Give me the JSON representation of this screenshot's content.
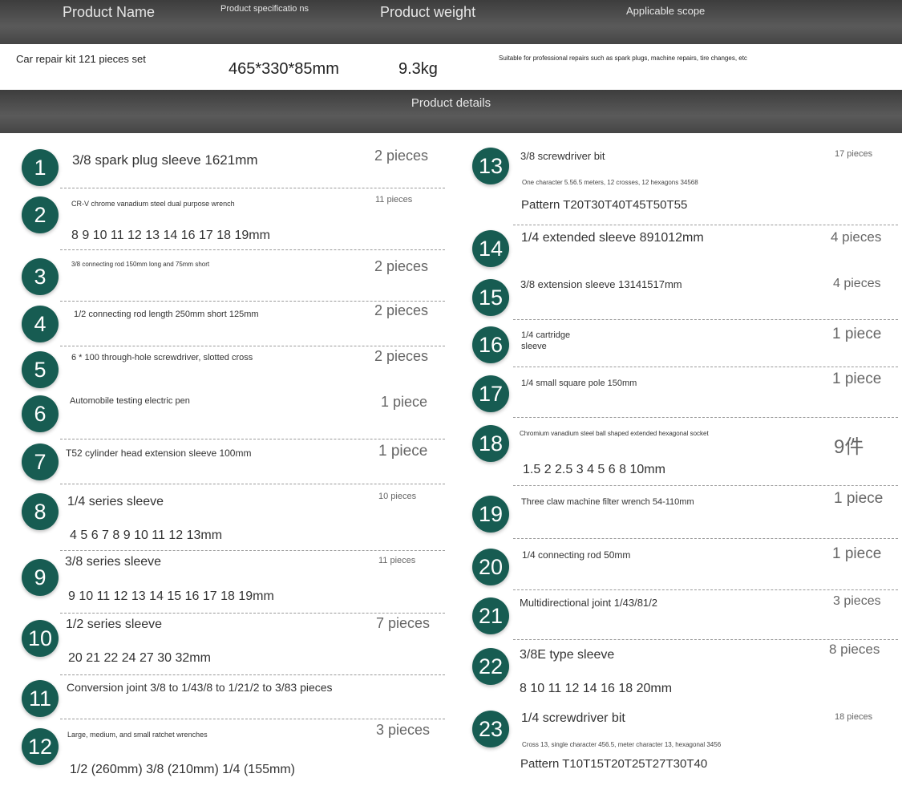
{
  "header": {
    "col_name": "Product Name",
    "col_spec": "Product specificatio ns",
    "col_weight": "Product weight",
    "col_scope": "Applicable scope"
  },
  "product": {
    "name": "Car repair kit 121 pieces set",
    "spec": "465*330*85mm",
    "weight": "9.3kg",
    "scope": "Suitable for professional repairs such as spark plugs, machine repairs, tire changes, etc"
  },
  "details_title": "Product details",
  "items": [
    {
      "num": "1",
      "name": "3/8 spark plug sleeve 1621mm",
      "qty": "2 pieces"
    },
    {
      "num": "2",
      "name": "CR-V chrome vanadium steel dual purpose wrench",
      "qty": "11 pieces",
      "sub": "8 9 10 11 12 13 14 16 17 18 19mm"
    },
    {
      "num": "3",
      "name": "3/8 connecting rod 150mm long and 75mm short",
      "qty": "2 pieces"
    },
    {
      "num": "4",
      "name": "1/2 connecting rod length 250mm short 125mm",
      "qty": "2 pieces"
    },
    {
      "num": "5",
      "name": "6 * 100 through-hole screwdriver, slotted cross",
      "qty": "2 pieces"
    },
    {
      "num": "6",
      "name": "Automobile testing electric pen",
      "qty": "1 piece"
    },
    {
      "num": "7",
      "name": "T52 cylinder head extension sleeve 100mm",
      "qty": "1 piece"
    },
    {
      "num": "8",
      "name": "1/4 series sleeve",
      "qty": "10 pieces",
      "sub": "4 5 6 7 8 9 10 11 12 13mm"
    },
    {
      "num": "9",
      "name": "3/8 series sleeve",
      "qty": "11 pieces",
      "sub": "9 10 11 12 13 14 15 16 17 18 19mm"
    },
    {
      "num": "10",
      "name": "1/2 series sleeve",
      "qty": "7 pieces",
      "sub": "20 21 22 24 27 30 32mm"
    },
    {
      "num": "11",
      "name": "Conversion joint 3/8 to 1/43/8 to 1/21/2 to 3/83 pieces"
    },
    {
      "num": "12",
      "name": "Large, medium, and small ratchet wrenches",
      "qty": "3 pieces",
      "sub": "1/2 (260mm) 3/8 (210mm) 1/4 (155mm)"
    },
    {
      "num": "13",
      "name": "3/8 screwdriver bit",
      "qty": "17 pieces",
      "note": "One character 5.56.5 meters, 12 crosses, 12 hexagons 34568",
      "sub": "Pattern T20T30T40T45T50T55"
    },
    {
      "num": "14",
      "name": "1/4 extended sleeve 891012mm",
      "qty": "4 pieces"
    },
    {
      "num": "15",
      "name": "3/8 extension sleeve 13141517mm",
      "qty": "4 pieces"
    },
    {
      "num": "16",
      "name": "1/4 cartridge sleeve",
      "qty": "1 piece"
    },
    {
      "num": "17",
      "name": "1/4 small square pole 150mm",
      "qty": "1 piece"
    },
    {
      "num": "18",
      "name": "Chromium vanadium steel ball shaped extended hexagonal socket",
      "qty": "9件",
      "sub": "1.5 2 2.5 3 4 5 6 8 10mm"
    },
    {
      "num": "19",
      "name": "Three claw machine filter wrench 54-110mm",
      "qty": "1 piece"
    },
    {
      "num": "20",
      "name": "1/4 connecting rod 50mm",
      "qty": "1 piece"
    },
    {
      "num": "21",
      "name": "Multidirectional joint 1/43/81/2",
      "qty": "3 pieces"
    },
    {
      "num": "22",
      "name": "3/8E type sleeve",
      "qty": "8 pieces",
      "sub": "8 10 11 12 14 16 18 20mm"
    },
    {
      "num": "23",
      "name": "1/4 screwdriver bit",
      "qty": "18 pieces",
      "note": "Cross 13, single character 456.5, meter character 13, hexagonal 3456",
      "sub": "Pattern T10T15T20T25T27T30T40"
    }
  ],
  "colors": {
    "accent": "#175c52",
    "bar": "#4a4a4a"
  }
}
